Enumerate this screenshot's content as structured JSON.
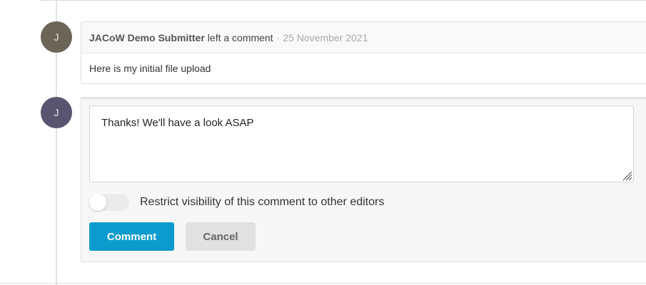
{
  "comment": {
    "avatar_initial": "J",
    "author": "JACoW Demo Submitter",
    "action": "left a comment",
    "separator": "·",
    "date": "25 November 2021",
    "body": "Here is my initial file upload"
  },
  "reply": {
    "avatar_initial": "J",
    "text": "Thanks! We'll have a look ASAP",
    "restrict_label": "Restrict visibility of this comment to other editors",
    "restrict_enabled": false,
    "submit_label": "Comment",
    "cancel_label": "Cancel"
  },
  "colors": {
    "primary": "#0b9ccd",
    "avatar_1": "#6a6557",
    "avatar_2": "#5a5470"
  }
}
